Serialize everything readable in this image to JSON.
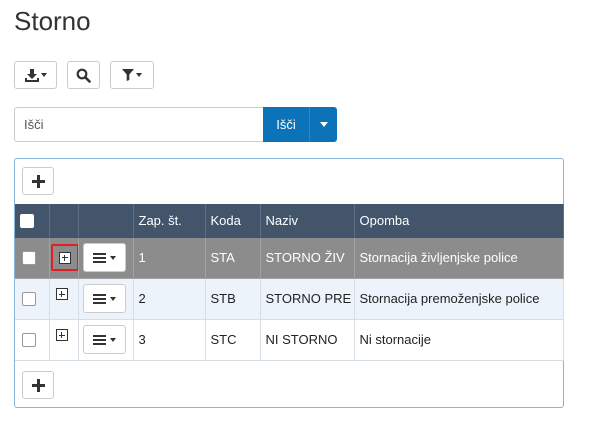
{
  "page": {
    "title": "Storno"
  },
  "toolbar": {
    "export_icon": "download-icon",
    "search_icon": "search-icon",
    "filter_icon": "filter-icon"
  },
  "search": {
    "placeholder": "Išči",
    "button_label": "Išči"
  },
  "table": {
    "columns": [
      "",
      "",
      "",
      "Zap. št.",
      "Koda",
      "Naziv",
      "Opomba"
    ],
    "rows": [
      {
        "zap": "1",
        "koda": "STA",
        "naziv": "STORNO ŽIV",
        "opomba": "Stornacija življenjske police",
        "state": "selected"
      },
      {
        "zap": "2",
        "koda": "STB",
        "naziv": "STORNO PRE",
        "opomba": "Stornacija premoženjske police",
        "state": "alt"
      },
      {
        "zap": "3",
        "koda": "STC",
        "naziv": "NI STORNO",
        "opomba": "Ni stornacije",
        "state": "plain"
      }
    ]
  },
  "colors": {
    "accent": "#0d73b8",
    "header_bg": "#42556b",
    "selected_row": "#8c8c8c",
    "highlight": "#e02020"
  }
}
